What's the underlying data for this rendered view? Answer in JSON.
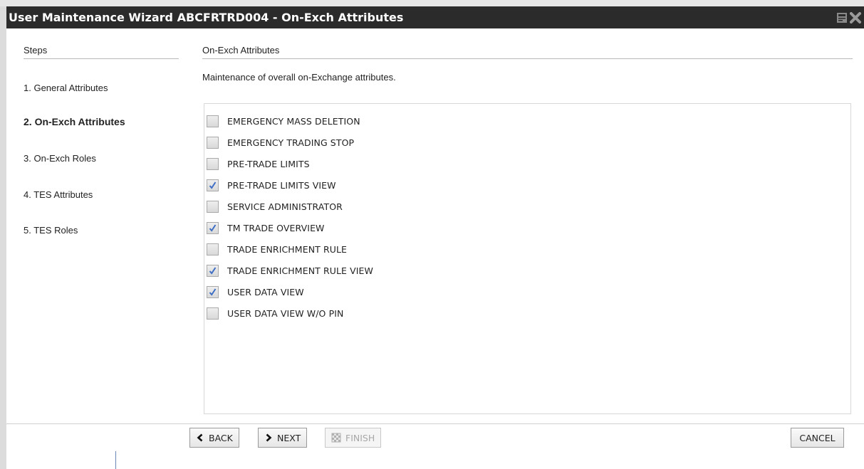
{
  "window": {
    "title": "User Maintenance Wizard ABCFRTRD004 - On-Exch Attributes",
    "icons": [
      "restore-icon",
      "close-icon"
    ]
  },
  "steps": {
    "header": "Steps",
    "items": [
      {
        "label": "1. General Attributes",
        "active": false
      },
      {
        "label": "2. On-Exch Attributes",
        "active": true
      },
      {
        "label": "3. On-Exch Roles",
        "active": false
      },
      {
        "label": "4. TES Attributes",
        "active": false
      },
      {
        "label": "5. TES Roles",
        "active": false
      }
    ]
  },
  "section": {
    "header": "On-Exch Attributes",
    "description": "Maintenance of overall on-Exchange attributes."
  },
  "attributes": [
    {
      "label": "EMERGENCY MASS DELETION",
      "checked": false
    },
    {
      "label": "EMERGENCY TRADING STOP",
      "checked": false
    },
    {
      "label": "PRE-TRADE LIMITS",
      "checked": false
    },
    {
      "label": "PRE-TRADE LIMITS VIEW",
      "checked": true
    },
    {
      "label": "SERVICE ADMINISTRATOR",
      "checked": false
    },
    {
      "label": "TM TRADE OVERVIEW",
      "checked": true
    },
    {
      "label": "TRADE ENRICHMENT RULE",
      "checked": false
    },
    {
      "label": "TRADE ENRICHMENT RULE VIEW",
      "checked": true
    },
    {
      "label": "USER DATA VIEW",
      "checked": true
    },
    {
      "label": "USER DATA VIEW W/O PIN",
      "checked": false
    }
  ],
  "buttons": {
    "back": {
      "label": "BACK",
      "icon": "chevron-left-icon",
      "enabled": true
    },
    "next": {
      "label": "NEXT",
      "icon": "chevron-right-icon",
      "enabled": true
    },
    "finish": {
      "label": "FINISH",
      "icon": "finish-flag-icon",
      "enabled": false
    },
    "cancel": {
      "label": "CANCEL",
      "enabled": true
    }
  },
  "colors": {
    "titlebar": "#2b2b2b",
    "checkmark": "#3f6fc5"
  }
}
